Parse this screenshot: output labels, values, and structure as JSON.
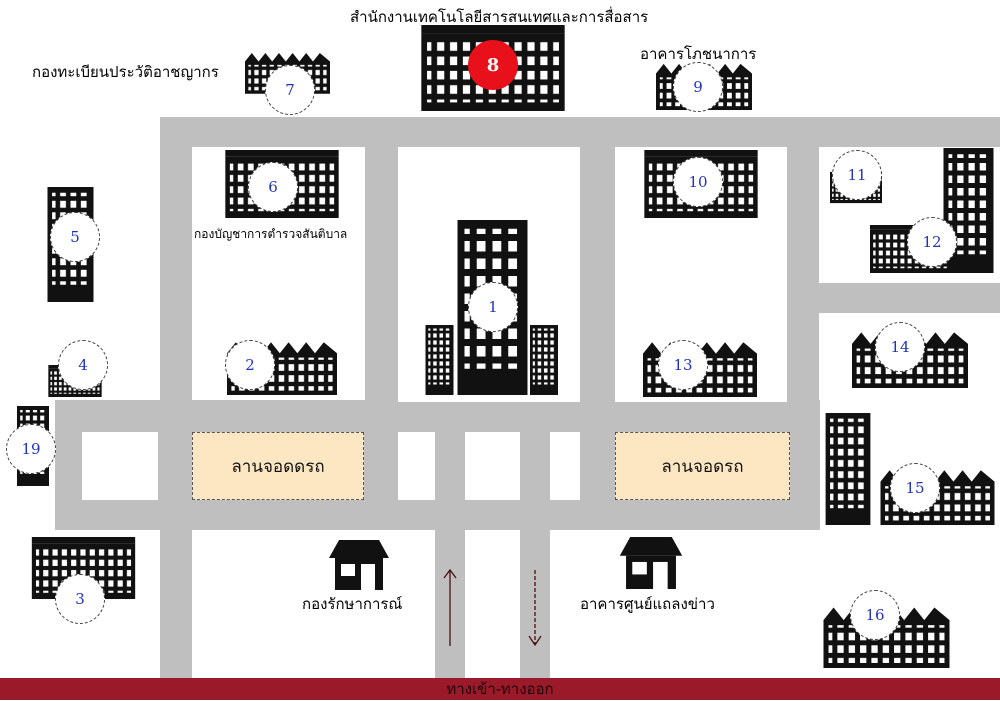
{
  "title_top": "สำนักงานเทคโนโลยีสารสนเทศและการสื่อสาร",
  "labels": {
    "registration": "กองทะเบียนประวัติอาชญากร",
    "canteen": "อาคารโภชนาการ",
    "forensic_hq": "กองบัญชาการตำรวจสันติบาล",
    "welfare": "กองรักษาการณ์",
    "press": "อาคารศูนย์แถลงข่าว",
    "parking_left": "ลานจอดดรถ",
    "parking_right": "ลานจอดรถ",
    "entrance": "ทางเข้า-ทางออก"
  },
  "markers": [
    "1",
    "2",
    "3",
    "4",
    "5",
    "6",
    "7",
    "8",
    "9",
    "10",
    "11",
    "12",
    "13",
    "14",
    "15",
    "16",
    "19"
  ],
  "colors": {
    "road": "#bfbfbf",
    "lot": "#fde7c3",
    "highlight": "#e8101a",
    "footer": "#9b1a2a",
    "marker_text": "#2233bb"
  }
}
